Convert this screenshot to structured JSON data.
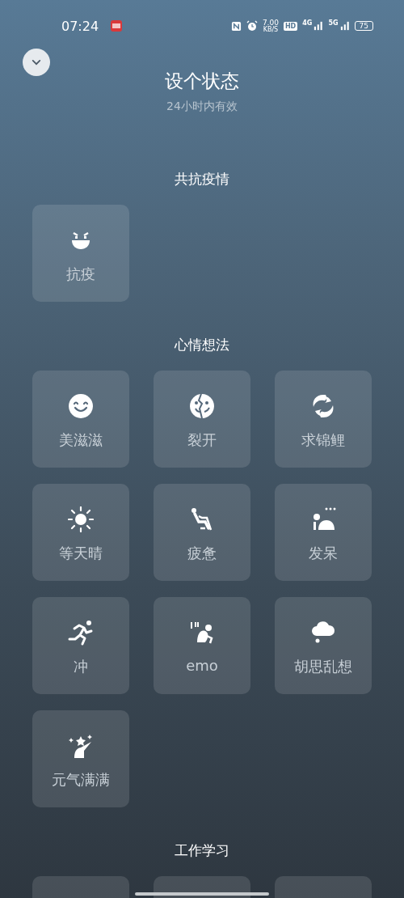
{
  "status_bar": {
    "time": "07:24",
    "speed": "7.00",
    "speed_unit": "KB/S",
    "hd": "HD",
    "net1": "4G",
    "net2": "5G",
    "battery": "75"
  },
  "header": {
    "title": "设个状态",
    "subtitle": "24小时内有效"
  },
  "sections": [
    {
      "title": "共抗疫情",
      "tiles": [
        {
          "kind": "mask",
          "label": "抗疫"
        }
      ]
    },
    {
      "title": "心情想法",
      "tiles": [
        {
          "kind": "smile",
          "label": "美滋滋"
        },
        {
          "kind": "cracked",
          "label": "裂开"
        },
        {
          "kind": "koi",
          "label": "求锦鲤"
        },
        {
          "kind": "sun",
          "label": "等天晴"
        },
        {
          "kind": "slump",
          "label": "疲惫"
        },
        {
          "kind": "daze",
          "label": "发呆"
        },
        {
          "kind": "run",
          "label": "冲"
        },
        {
          "kind": "crouch",
          "label": "emo"
        },
        {
          "kind": "cloud",
          "label": "胡思乱想"
        },
        {
          "kind": "sparkle",
          "label": "元气满满"
        }
      ]
    },
    {
      "title": "工作学习",
      "tiles": [
        {
          "kind": "cut"
        },
        {
          "kind": "cut"
        },
        {
          "kind": "cut"
        }
      ]
    }
  ]
}
